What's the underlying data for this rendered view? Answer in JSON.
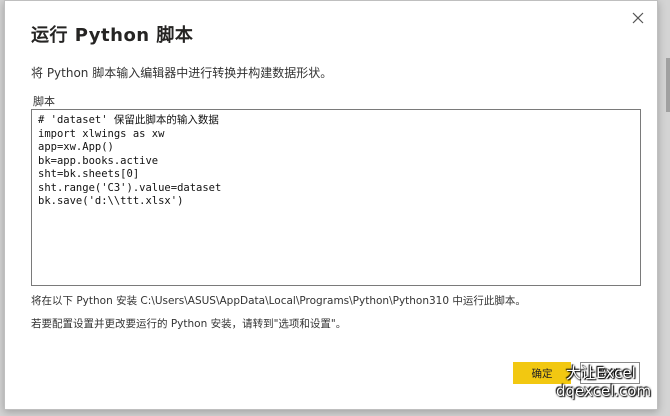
{
  "dialog": {
    "title": "运行 Python 脚本",
    "description": "将 Python 脚本输入编辑器中进行转换并构建数据形状。",
    "close_icon": "close-icon"
  },
  "editor": {
    "label": "脚本",
    "code": "# 'dataset' 保留此脚本的输入数据\nimport xlwings as xw\napp=xw.App()\nbk=app.books.active\nsht=bk.sheets[0]\nsht.range('C3').value=dataset\nbk.save('d:\\\\ttt.xlsx')"
  },
  "notes": {
    "path_note": "将在以下 Python 安装 C:\\Users\\ASUS\\AppData\\Local\\Programs\\Python\\Python310 中运行此脚本。",
    "config_note_prefix": "若要配置设置并更改要运行的 Python 安装，请转到",
    "config_note_link": "\"选项和设置\"",
    "config_note_suffix": "。"
  },
  "buttons": {
    "ok_label": "确定",
    "cancel_label": "取消"
  },
  "watermark": {
    "line1": "大让Excel",
    "line2": "dqexcel.com"
  },
  "colors": {
    "ok_button": "#f2c811",
    "title_text": "#252423"
  }
}
